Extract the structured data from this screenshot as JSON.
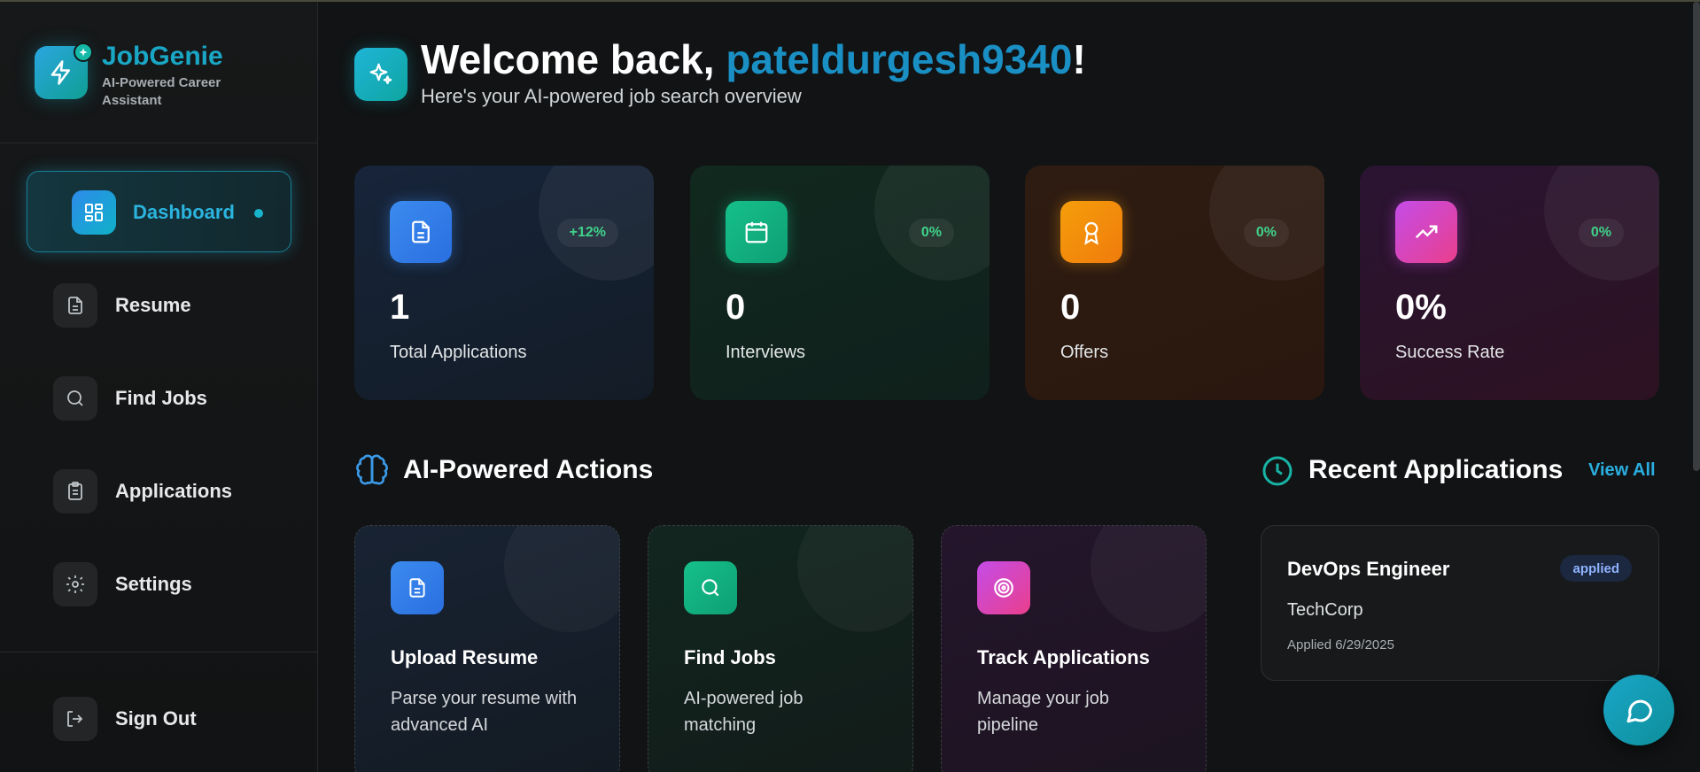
{
  "brand": {
    "name": "JobGenie",
    "tagline": "AI-Powered Career Assistant"
  },
  "sidebar": {
    "items": [
      {
        "label": "Dashboard",
        "icon": "dashboard-icon",
        "active": true
      },
      {
        "label": "Resume",
        "icon": "file-icon"
      },
      {
        "label": "Find Jobs",
        "icon": "search-icon"
      },
      {
        "label": "Applications",
        "icon": "clipboard-icon"
      },
      {
        "label": "Settings",
        "icon": "gear-icon"
      }
    ],
    "sign_out": "Sign Out"
  },
  "header": {
    "welcome_prefix": "Welcome back, ",
    "username": "pateldurgesh9340",
    "welcome_suffix": "!",
    "subtitle": "Here's your AI-powered job search overview"
  },
  "stats": [
    {
      "value": "1",
      "label": "Total Applications",
      "change": "+12%",
      "icon": "document-icon",
      "color": "#2f80ed"
    },
    {
      "value": "0",
      "label": "Interviews",
      "change": "0%",
      "icon": "calendar-icon",
      "color": "#10b981"
    },
    {
      "value": "0",
      "label": "Offers",
      "change": "0%",
      "icon": "award-icon",
      "color": "#f59e0b"
    },
    {
      "value": "0%",
      "label": "Success Rate",
      "change": "0%",
      "icon": "trending-up-icon",
      "color": "#d946ef"
    }
  ],
  "actions_section": {
    "title": "AI-Powered Actions"
  },
  "actions": [
    {
      "title": "Upload Resume",
      "description": "Parse your resume with advanced AI",
      "icon": "document-icon"
    },
    {
      "title": "Find Jobs",
      "description": "AI-powered job matching",
      "icon": "search-icon"
    },
    {
      "title": "Track Applications",
      "description": "Manage your job pipeline",
      "icon": "target-icon"
    }
  ],
  "recent": {
    "title": "Recent Applications",
    "view_all": "View All",
    "items": [
      {
        "role": "DevOps Engineer",
        "status": "applied",
        "company": "TechCorp",
        "date": "Applied 6/29/2025"
      }
    ]
  }
}
